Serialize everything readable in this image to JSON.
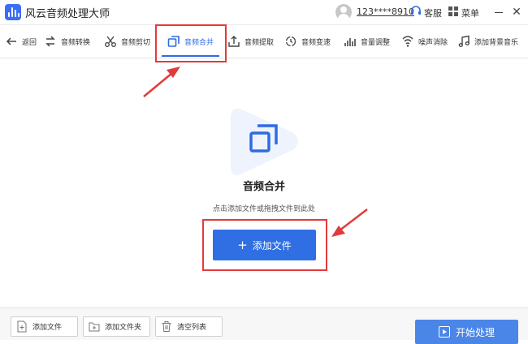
{
  "app": {
    "title": "风云音频处理大师"
  },
  "user": {
    "name": "123****8910",
    "support": "客服",
    "menu": "菜单"
  },
  "toolbar": {
    "items": [
      {
        "label": "返回",
        "icon": "back-arrow-icon"
      },
      {
        "label": "音频转换",
        "icon": "convert-icon"
      },
      {
        "label": "音频剪切",
        "icon": "scissors-icon"
      },
      {
        "label": "音频合并",
        "icon": "merge-icon",
        "active": true
      },
      {
        "label": "音频提取",
        "icon": "extract-icon"
      },
      {
        "label": "音频变速",
        "icon": "speed-icon"
      },
      {
        "label": "音量调整",
        "icon": "volume-bars-icon"
      },
      {
        "label": "噪声消除",
        "icon": "noise-icon"
      },
      {
        "label": "添加背景音乐",
        "icon": "music-note-icon"
      }
    ]
  },
  "main": {
    "title": "音频合并",
    "hint": "点击添加文件或拖拽文件到此处",
    "add_button": "添加文件"
  },
  "bottom": {
    "add_file": "添加文件",
    "add_folder": "添加文件夹",
    "clear_list": "清空列表",
    "start": "开始处理"
  },
  "colors": {
    "accent": "#2f6fe3",
    "annotation": "#e23b3b"
  }
}
